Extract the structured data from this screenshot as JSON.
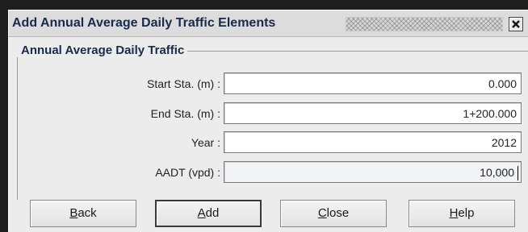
{
  "window": {
    "title": "Add Annual Average Daily Traffic Elements",
    "close_icon": "close-x-icon"
  },
  "group": {
    "label": "Annual Average Daily Traffic"
  },
  "fields": [
    {
      "label": "Start Sta. (m) :",
      "value": "0.000"
    },
    {
      "label": "End Sta. (m) :",
      "value": "1+200.000"
    },
    {
      "label": "Year :",
      "value": "2012"
    },
    {
      "label": "AADT (vpd) :",
      "value": "10,000"
    }
  ],
  "buttons": {
    "back": {
      "mnemonic": "B",
      "rest": "ack"
    },
    "add": {
      "mnemonic": "A",
      "rest": "dd"
    },
    "close": {
      "mnemonic": "C",
      "rest": "lose"
    },
    "help": {
      "mnemonic": "H",
      "rest": "elp"
    }
  }
}
